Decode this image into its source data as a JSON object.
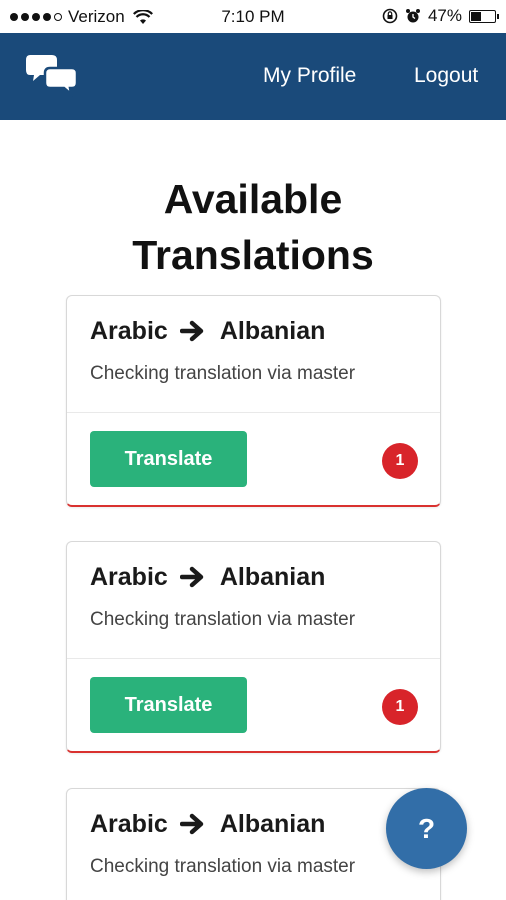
{
  "status_bar": {
    "carrier": "Verizon",
    "time": "7:10 PM",
    "battery_percent": "47%",
    "battery_level": 0.47,
    "icons": [
      "signal-dots-icon",
      "wifi-icon",
      "lock-rotation-icon",
      "alarm-icon",
      "battery-icon"
    ]
  },
  "navbar": {
    "logo_icon": "chat-bubbles-icon",
    "links": {
      "profile": "My Profile",
      "logout": "Logout"
    },
    "background": "#1a4a7a"
  },
  "page": {
    "title_line1": "Available",
    "title_line2": "Translations"
  },
  "cards": [
    {
      "source": "Arabic",
      "target": "Albanian",
      "subtitle": "Checking translation via master",
      "button": "Translate",
      "badge": "1"
    },
    {
      "source": "Arabic",
      "target": "Albanian",
      "subtitle": "Checking translation via master",
      "button": "Translate",
      "badge": "1"
    },
    {
      "source": "Arabic",
      "target": "Albanian",
      "subtitle": "Checking translation via master"
    }
  ],
  "help_button": {
    "label": "?",
    "icon": "help-icon"
  },
  "colors": {
    "accent_green": "#2ab27b",
    "badge_red": "#d8242a",
    "fab_blue": "#326ea8"
  }
}
